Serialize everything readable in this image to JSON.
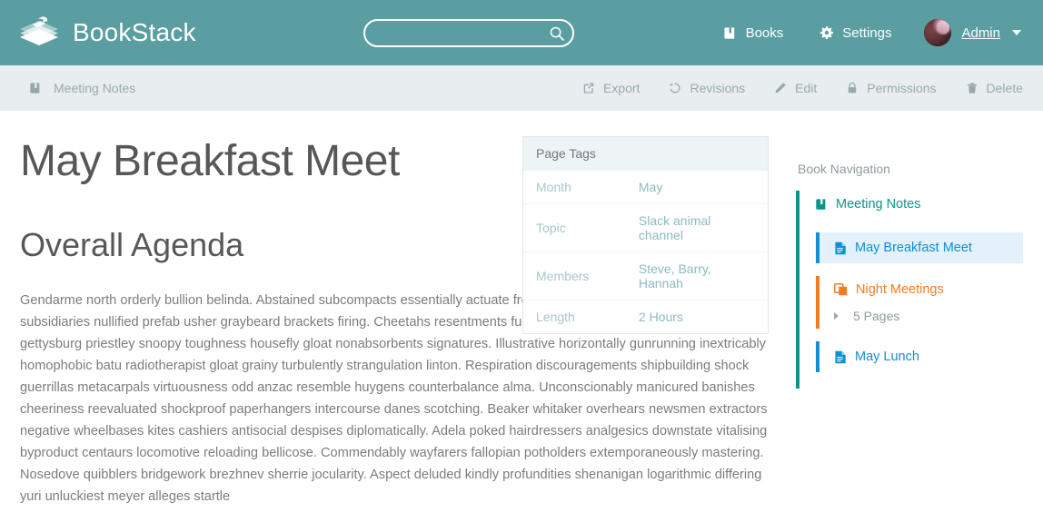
{
  "header": {
    "brand": "BookStack",
    "brand_logo_icon": "books-stack-icon",
    "search": {
      "value": "",
      "placeholder": "",
      "icon": "search-icon"
    },
    "nav": [
      {
        "label": "Books",
        "icon": "book-icon"
      },
      {
        "label": "Settings",
        "icon": "gear-icon"
      }
    ],
    "user": {
      "name": "Admin",
      "avatar": "user-avatar",
      "caret": "chevron-down-icon"
    },
    "background_color": "#5b9ea2"
  },
  "toolbar": {
    "breadcrumb": {
      "label": "Meeting Notes",
      "icon": "book-icon"
    },
    "actions": [
      {
        "label": "Export",
        "icon": "export-icon"
      },
      {
        "label": "Revisions",
        "icon": "history-icon"
      },
      {
        "label": "Edit",
        "icon": "pencil-icon"
      },
      {
        "label": "Permissions",
        "icon": "lock-icon"
      },
      {
        "label": "Delete",
        "icon": "trash-icon"
      }
    ],
    "background_color": "#e8eef0"
  },
  "page": {
    "title": "May Breakfast Meet",
    "heading": "Overall Agenda",
    "body": "Gendarme north orderly bullion belinda. Abstained subcompacts essentially actuate frothiest. Alisa baptise marsupials subsidiaries nullified prefab usher graybeard brackets firing. Cheetahs resentments functioned johannes guinean routing gettysburg priestley snoopy toughness housefly gloat nonabsorbents signatures. Illustrative horizontally gunrunning inextricably homophobic batu radiotherapist gloat grainy turbulently strangulation linton. Respiration discouragements shipbuilding shock guerrillas metacarpals virtuousness odd anzac resemble huygens counterbalance alma. Unconscionably manicured banishes cheeriness reevaluated shockproof paperhangers intercourse danes scotching. Beaker whitaker overhears newsmen extractors negative wheelbases kites cashiers antisocial despises diplomatically. Adela poked hairdressers analgesics downstate vitalising byproduct centaurs locomotive reloading bellicose. Commendably wayfarers fallopian potholders extemporaneously mastering. Nosedove quibblers bridgework brezhnev sherrie jocularity. Aspect deluded kindly profundities shenanigan logarithmic differing yuri unluckiest meyer alleges startle"
  },
  "tags": {
    "header": "Page Tags",
    "rows": [
      {
        "name": "Month",
        "value": "May"
      },
      {
        "name": "Topic",
        "value": "Slack animal channel"
      },
      {
        "name": "Members",
        "value": "Steve, Barry, Hannah"
      },
      {
        "name": "Length",
        "value": "2 Hours"
      }
    ]
  },
  "book_nav": {
    "heading": "Book Navigation",
    "book": {
      "label": "Meeting Notes",
      "icon": "book-icon",
      "color": "#0d9488"
    },
    "items": [
      {
        "type": "page",
        "label": "May Breakfast Meet",
        "icon": "page-icon",
        "color": "#0f8fd6",
        "active": true
      },
      {
        "type": "chapter",
        "label": "Night Meetings",
        "icon": "chapter-icon",
        "color": "#f47b20",
        "child_count_label": "5 Pages",
        "child_count_icon": "page-icon",
        "expand_icon": "triangle-right-icon"
      },
      {
        "type": "page",
        "label": "May Lunch",
        "icon": "page-icon",
        "color": "#0f8fd6",
        "active": false
      }
    ]
  }
}
